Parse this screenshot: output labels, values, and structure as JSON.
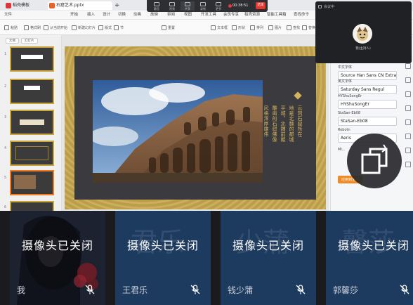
{
  "browser_tabs": [
    {
      "label": "稻壳模板",
      "color": "#d9363e"
    },
    {
      "label": "石窟艺术.pptx",
      "color": "#e5632a"
    }
  ],
  "ribbon_menu": [
    "开始",
    "插入",
    "设计",
    "切换",
    "动画",
    "放映",
    "审阅",
    "视图",
    "开发工具",
    "会员专享",
    "稻壳资源",
    "智能工具箱",
    "查找命令"
  ],
  "file_menu": "文件",
  "ribbon_tools": [
    "粘贴",
    "格式刷",
    "从当前开始",
    "新建幻灯片",
    "版式",
    "节",
    "重置",
    "文本框",
    "形状",
    "排列",
    "图片",
    "查找",
    "替换"
  ],
  "meeting_bar": {
    "buttons": [
      "静音",
      "视频",
      "共享",
      "录制",
      "更多"
    ],
    "timer": "00:38:51",
    "end_label": "结束"
  },
  "thumbnails": {
    "tabs": [
      "大纲",
      "幻灯片"
    ],
    "numbers": [
      "1",
      "2",
      "3",
      "4",
      "5",
      "6"
    ]
  },
  "slide": {
    "vertical_text": [
      "云冈石窟所在",
      "地是北魏的都城",
      "平城，北魏前期",
      "雕凿的石窟佛像",
      "风格浑厚雄伟"
    ],
    "accent_color": "#d4b35c"
  },
  "right_panel": {
    "fonts": [
      {
        "label": "中文字体",
        "name": "Source Han Sans CN Extral..."
      },
      {
        "label": "英文字体",
        "name": "Saturday Sans Regul"
      },
      {
        "label": "HYShuSongEr",
        "name": "HYShuSongEr"
      },
      {
        "label": "StaSan-Eb08",
        "name": "StaSan-Eb08"
      },
      {
        "label": "Robotn",
        "name": "Aeris"
      },
      {
        "label": "Mi...",
        "name": "Mi..."
      }
    ],
    "apply_label": "应用到全部"
  },
  "call_panel": {
    "title": "会议中",
    "self_name": "我(主持人)"
  },
  "participants": [
    {
      "status": "摄像头已关闭",
      "name": "我",
      "bg_name": "",
      "bg": "#1a1f2a"
    },
    {
      "status": "摄像头已关闭",
      "name": "王君乐",
      "bg_name": "君乐",
      "bg": "#1d3a5f"
    },
    {
      "status": "摄像头已关闭",
      "name": "钱少蒲",
      "bg_name": "少蒲",
      "bg": "#1d3a5f"
    },
    {
      "status": "摄像头已关闭",
      "name": "郭馨莎",
      "bg_name": "馨莎",
      "bg": "#1d3a5f"
    }
  ]
}
